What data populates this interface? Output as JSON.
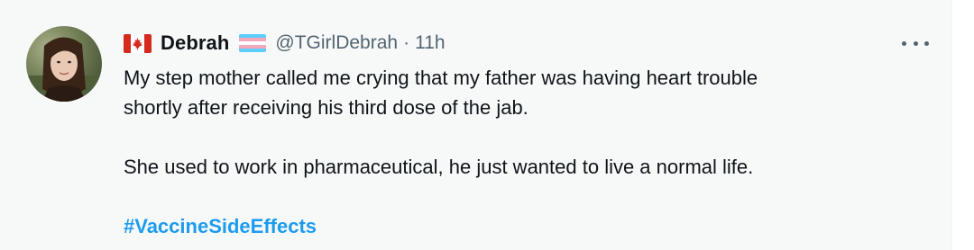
{
  "tweet": {
    "author": {
      "country_flag_icon": "canada-flag-icon",
      "name": "Debrah",
      "badge_icon": "transgender-flag-icon",
      "handle": "@TGirlDebrah",
      "separator": "·",
      "time": "11h"
    },
    "more_icon": "more-horizontal-icon",
    "text": {
      "line1": "My step mother called me crying that my father was having heart trouble",
      "line2": "shortly after receiving his third dose of the jab.",
      "line3": "She used to work in pharmaceutical, he just wanted to live a normal life."
    },
    "hashtag": "#VaccineSideEffects"
  },
  "colors": {
    "background": "#f7f9f9",
    "text": "#0f1419",
    "secondary_text": "#536471",
    "link": "#1d9bf0",
    "canada_red": "#d52b1e",
    "trans_blue": "#5bcefa",
    "trans_pink": "#f5a9b8"
  }
}
